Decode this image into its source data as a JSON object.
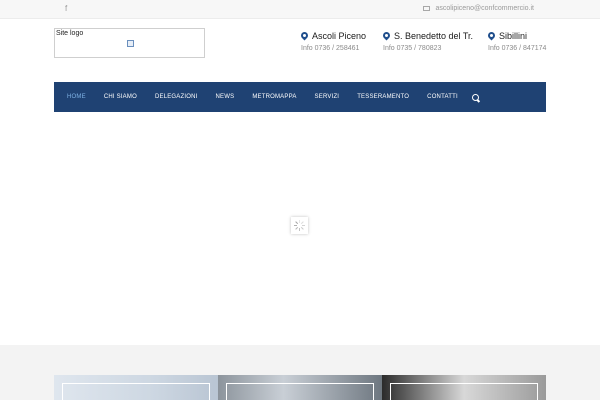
{
  "topbar": {
    "social_icon": "facebook-icon",
    "email_icon": "envelope-icon",
    "email": "ascolipiceno@confcommercio.it"
  },
  "logo": {
    "alt_text": "Site logo"
  },
  "locations": [
    {
      "name": "Ascoli Piceno",
      "phone": "Info 0736 / 258461"
    },
    {
      "name": "S. Benedetto del Tr.",
      "phone": "Info 0735 / 780823"
    },
    {
      "name": "Sibillini",
      "phone": "Info 0736 / 847174"
    }
  ],
  "nav": {
    "items": [
      "HOME",
      "CHI SIAMO",
      "DELEGAZIONI",
      "NEWS",
      "METROMAPPA",
      "SERVIZI",
      "TESSERAMENTO",
      "CONTATTI"
    ],
    "active": "HOME",
    "search_icon": "search-icon"
  },
  "colors": {
    "nav_bg": "#1f4273",
    "accent": "#7fb3e6",
    "pin": "#1f4e8c"
  }
}
